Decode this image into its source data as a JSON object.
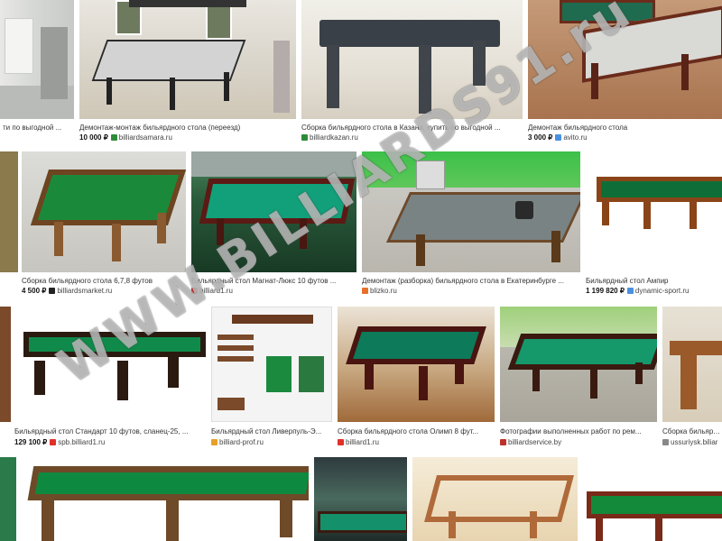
{
  "watermark": "WWW.BILLIARDS91.ru",
  "row1": [
    {
      "caption": "ти по выгодной ...",
      "price": "",
      "source": "",
      "fav": "#888"
    },
    {
      "caption": "Демонтаж-монтаж бильярдного стола (переезд)",
      "price": "10 000 ₽",
      "source": "billiardsamara.ru",
      "fav": "#2e8b3a"
    },
    {
      "caption": "Сборка бильярдного стола в Казани, купить по выгодной ...",
      "price": "",
      "source": "billiardkazan.ru",
      "fav": "#2e8b3a"
    },
    {
      "caption": "Демонтаж бильярдного стола",
      "price": "3 000 ₽",
      "source": "avito.ru",
      "fav": "#4a90e2"
    }
  ],
  "row2": [
    {
      "caption": "Сборка бильярдного стола 6,7,8 футов",
      "price": "4 500 ₽",
      "source": "billiardsmarket.ru",
      "fav": "#222"
    },
    {
      "caption": "Бильярдный стол Магнат-Люкс 10 футов ...",
      "price": "",
      "source": "billiard1.ru",
      "fav": "#e0302a"
    },
    {
      "caption": "Демонтаж (разборка) бильярдного стола в Екатеринбурге ...",
      "price": "",
      "source": "blizko.ru",
      "fav": "#e8702a"
    },
    {
      "caption": "Бильярдный стол Ампир",
      "price": "1 199 820 ₽",
      "source": "dynamic-sport.ru",
      "fav": "#4a90e2"
    }
  ],
  "row3": [
    {
      "caption": "Бильярдный стол Стандарт 10 футов, сланец-25, ...",
      "price": "129 100 ₽",
      "source": "spb.billiard1.ru",
      "fav": "#e0302a"
    },
    {
      "caption": "Бильярдный стол Ливерпуль-Э...",
      "price": "",
      "source": "billiard-prof.ru",
      "fav": "#e8a02a"
    },
    {
      "caption": "Сборка бильярдного стола Олимп 8 фут...",
      "price": "",
      "source": "billiard1.ru",
      "fav": "#e0302a"
    },
    {
      "caption": "Фотографии выполненных работ по рем...",
      "price": "",
      "source": "billiardservice.by",
      "fav": "#c0302a"
    },
    {
      "caption": "Сборка бильярдного",
      "price": "",
      "source": "ussuriysk.biliar",
      "fav": "#888"
    }
  ]
}
